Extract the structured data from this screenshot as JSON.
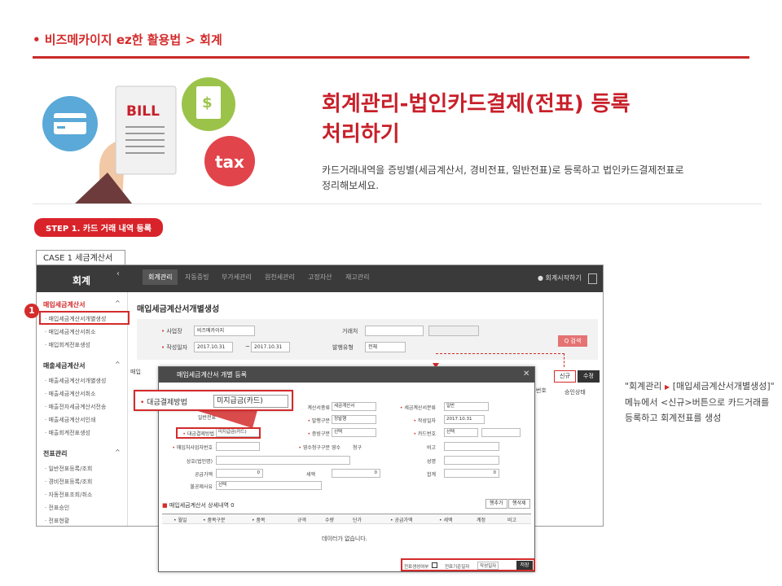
{
  "breadcrumb": "• 비즈메카이지 ez한 활용법 > 회계",
  "hero": {
    "title_line1": "회계관리-법인카드결제(전표) 등록",
    "title_line2": "처리하기",
    "desc_line1": "카드거래내역을 증빙별(세금계산서, 경비전표, 일반전표)로 등록하고 법인카드결제전표로",
    "desc_line2": "정리해보세요.",
    "icon_bill": "BILL",
    "icon_tax": "tax"
  },
  "step_label": "STEP 1.  카드 거래 내역 등록",
  "case_tab": "CASE 1  세금계산서",
  "app": {
    "logo": "회계",
    "nav": [
      "회계관리",
      "자동증빙",
      "부가세관리",
      "원천세관리",
      "고정자산",
      "재고관리"
    ],
    "start_menu": "● 회계시작하기",
    "sidebar": {
      "group1": "매입세금계산서",
      "group1_items": [
        "· 매입세금계산서개별생성",
        "· 매입세금계산서취소",
        "· 매입회계전표생성"
      ],
      "group2": "매출세금계산서",
      "group2_items": [
        "· 매출세금계산서개별생성",
        "· 매출세금계산서취소",
        "· 매출전자세금계산서전송",
        "· 매출세금계산서인쇄",
        "· 매출회계전표생성"
      ],
      "group3": "전표관리",
      "group3_items": [
        "· 일반전표등록/조회",
        "· 경비전표등록/조회",
        "· 자동전표조회/취소",
        "· 전표승인",
        "· 전표현황"
      ]
    },
    "badge": "1",
    "page_title": "매입세금계산서개별생성",
    "filter": {
      "site_label": "사업장",
      "site_value": "비즈메카이지",
      "date_label": "작성일자",
      "date_from": "2017.10.31",
      "date_sep": "~",
      "date_to": "2017.10.31",
      "vendor_label": "거래처",
      "type_label": "발행유형",
      "type_value": "전체",
      "search_btn": "Q 검색"
    },
    "btn_new": "신규",
    "btn_edit": "수정",
    "grid_cols": [
      "전표번호",
      "승인상태"
    ],
    "list_title_partial": "매입"
  },
  "modal": {
    "title": "매입세금계산서 개별 등록",
    "close": "✕",
    "fields": {
      "tax_type_label": "계산서종류",
      "tax_type_value": "세금계산서",
      "tax_class_label": "세금계산서분류",
      "tax_class_value": "일반",
      "issue_label": "발행구분",
      "issue_value": "정발행",
      "write_date_label": "작성일자",
      "write_date_value": "2017.10.31",
      "vendor_no_label": "일반전표",
      "settle_label": "대금결제방법",
      "settle_value": "미지급금(카드)",
      "evidence_label": "증빙구분",
      "evidence_value": "선택",
      "card_label": "카드번호",
      "card_value": "선택",
      "biz_no_label": "매입처사업자번호",
      "receipt_label": "영수청구구분",
      "receipt_opt1": "영수",
      "receipt_opt2": "청구",
      "memo_label": "비고",
      "company_label": "상호(법인명)",
      "name_label": "성명",
      "supply_label": "공급가액",
      "supply_value": "0",
      "tax_label": "세액",
      "tax_value": "0",
      "total_label": "합계",
      "total_value": "0",
      "reason_label": "불공제사유",
      "reason_value": "선택"
    },
    "detail_title": "매입세금계산서 상세내역 0",
    "btn_add": "행추가",
    "btn_del": "행삭제",
    "detail_cols": [
      "• 월일",
      "• 품목구분",
      "• 품목",
      "규격",
      "수량",
      "단가",
      "• 공급가액",
      "• 세액",
      "계정",
      "비고"
    ],
    "no_data": "데이터가 없습니다.",
    "foot_autogen": "전표생성여부",
    "foot_date_label": "전표기준일자",
    "foot_date_value": "작성일자",
    "foot_save": "저장"
  },
  "callout": {
    "label": "대금결제방법",
    "value": "미지급금(카드)"
  },
  "side_note": {
    "line1_prefix": "\"회계관리",
    "line1_suffix": "[매입세금계산서개별생성]\"",
    "line2": "메뉴에서 <신규>버튼으로 카드거래를",
    "line3": "등록하고 회계전표를 생성"
  }
}
